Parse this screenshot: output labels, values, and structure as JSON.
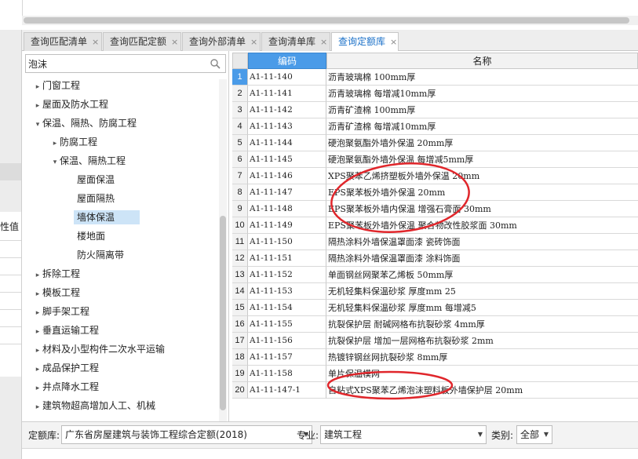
{
  "strip": {
    "label": "性值"
  },
  "tabs": [
    {
      "label": "查询匹配清单",
      "close": "×"
    },
    {
      "label": "查询匹配定额",
      "close": "×"
    },
    {
      "label": "查询外部清单",
      "close": "×"
    },
    {
      "label": "查询清单库",
      "close": "×"
    },
    {
      "label": "查询定额库",
      "close": "×",
      "active": true
    }
  ],
  "search": {
    "value": "泡沫"
  },
  "tree": [
    {
      "label": "门窗工程",
      "level": 1,
      "arrow": "▸"
    },
    {
      "label": "屋面及防水工程",
      "level": 1,
      "arrow": "▸"
    },
    {
      "label": "保温、隔热、防腐工程",
      "level": 1,
      "arrow": "▾"
    },
    {
      "label": "防腐工程",
      "level": 2,
      "arrow": "▸"
    },
    {
      "label": "保温、隔热工程",
      "level": 2,
      "arrow": "▾"
    },
    {
      "label": "屋面保温",
      "level": 3,
      "arrow": ""
    },
    {
      "label": "屋面隔热",
      "level": 3,
      "arrow": ""
    },
    {
      "label": "墙体保温",
      "level": 3,
      "arrow": "",
      "selected": true
    },
    {
      "label": "楼地面",
      "level": 3,
      "arrow": ""
    },
    {
      "label": "防火隔离带",
      "level": 3,
      "arrow": ""
    },
    {
      "label": "拆除工程",
      "level": 1,
      "arrow": "▸"
    },
    {
      "label": "模板工程",
      "level": 1,
      "arrow": "▸"
    },
    {
      "label": "脚手架工程",
      "level": 1,
      "arrow": "▸"
    },
    {
      "label": "垂直运输工程",
      "level": 1,
      "arrow": "▸"
    },
    {
      "label": "材料及小型构件二次水平运输",
      "level": 1,
      "arrow": "▸"
    },
    {
      "label": "成品保护工程",
      "level": 1,
      "arrow": "▸"
    },
    {
      "label": "井点降水工程",
      "level": 1,
      "arrow": "▸"
    },
    {
      "label": "建筑物超高增加人工、机械",
      "level": 1,
      "arrow": "▸"
    }
  ],
  "grid": {
    "col_code": "编码",
    "col_name": "名称",
    "rows": [
      {
        "n": "1",
        "code": "A1-11-140",
        "name": "沥青玻璃棉 100mm厚"
      },
      {
        "n": "2",
        "code": "A1-11-141",
        "name": "沥青玻璃棉 每增减10mm厚"
      },
      {
        "n": "3",
        "code": "A1-11-142",
        "name": "沥青矿渣棉 100mm厚"
      },
      {
        "n": "4",
        "code": "A1-11-143",
        "name": "沥青矿渣棉 每增减10mm厚"
      },
      {
        "n": "5",
        "code": "A1-11-144",
        "name": "硬泡聚氨酯外墙外保温 20mm厚"
      },
      {
        "n": "6",
        "code": "A1-11-145",
        "name": "硬泡聚氨酯外墙外保温 每增减5mm厚"
      },
      {
        "n": "7",
        "code": "A1-11-146",
        "name": "XPS聚苯乙烯挤塑板外墙外保温 20mm"
      },
      {
        "n": "8",
        "code": "A1-11-147",
        "name": "EPS聚苯板外墙外保温 20mm"
      },
      {
        "n": "9",
        "code": "A1-11-148",
        "name": "EPS聚苯板外墙内保温 增强石膏面 30mm"
      },
      {
        "n": "10",
        "code": "A1-11-149",
        "name": "EPS聚苯板外墙外保温 聚合物改性胶浆面 30mm"
      },
      {
        "n": "11",
        "code": "A1-11-150",
        "name": "隔热涂料外墙保温罩面漆 瓷砖饰面"
      },
      {
        "n": "12",
        "code": "A1-11-151",
        "name": "隔热涂料外墙保温罩面漆 涂料饰面"
      },
      {
        "n": "13",
        "code": "A1-11-152",
        "name": "单面钢丝网聚苯乙烯板 50mm厚"
      },
      {
        "n": "14",
        "code": "A1-11-153",
        "name": "无机轻集料保温砂浆 厚度mm 25"
      },
      {
        "n": "15",
        "code": "A1-11-154",
        "name": "无机轻集料保温砂浆 厚度mm 每增减5"
      },
      {
        "n": "16",
        "code": "A1-11-155",
        "name": "抗裂保护层 耐碱网格布抗裂砂浆 4mm厚"
      },
      {
        "n": "17",
        "code": "A1-11-156",
        "name": "抗裂保护层 增加一层网格布抗裂砂浆 2mm"
      },
      {
        "n": "18",
        "code": "A1-11-157",
        "name": "热镀锌钢丝网抗裂砂浆 8mm厚"
      },
      {
        "n": "19",
        "code": "A1-11-158",
        "name": "单片保温模网"
      },
      {
        "n": "20",
        "code": "A1-11-147-1",
        "name": "自粘式XPS聚苯乙烯泡沫塑料板外墙保护层 20mm"
      }
    ]
  },
  "bottom": {
    "quota_label": "定额库:",
    "quota_value": "广东省房屋建筑与装饰工程综合定额(2018)",
    "major_label": "专业:",
    "major_value": "建筑工程",
    "category_label": "类别:",
    "category_value": "全部"
  },
  "colors": {
    "accent": "#4a9be8",
    "annotation": "#e0262b",
    "active_tab_text": "#1a70c8",
    "selected_row": "#cde4f7"
  }
}
